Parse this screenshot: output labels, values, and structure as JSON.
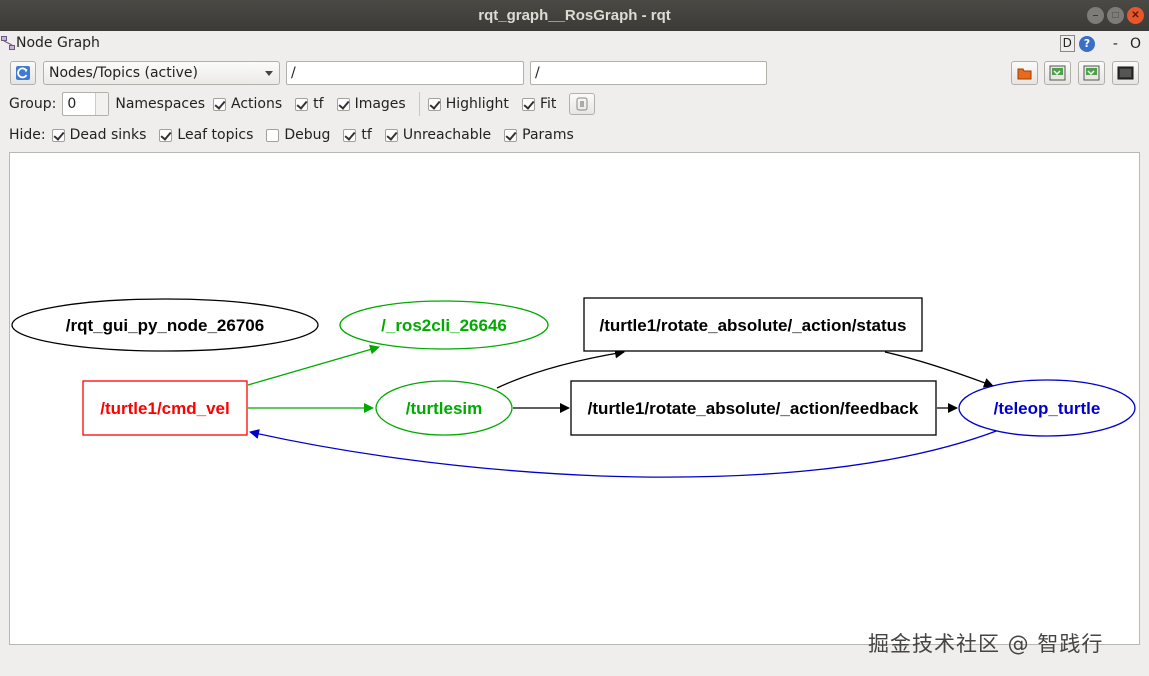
{
  "window": {
    "title": "rqt_graph__RosGraph - rqt",
    "plugin_title": "Node Graph",
    "top_right": {
      "d_label": "D",
      "help": "?",
      "dash": "-",
      "o": "O"
    }
  },
  "toolbar": {
    "refresh_icon": "refresh-icon",
    "mode": "Nodes/Topics (active)",
    "node_filter": "/",
    "topic_filter": "/",
    "buttons": [
      "load-dot-icon",
      "save-dot-icon",
      "save-svg-icon",
      "save-image-icon"
    ]
  },
  "options": {
    "group_label": "Group:",
    "group_value": "0",
    "namespaces": "Namespaces",
    "actions": {
      "label": "Actions",
      "checked": true
    },
    "tf": {
      "label": "tf",
      "checked": true
    },
    "images": {
      "label": "Images",
      "checked": true
    },
    "highlight": {
      "label": "Highlight",
      "checked": true
    },
    "fit": {
      "label": "Fit",
      "checked": true
    }
  },
  "hide": {
    "label": "Hide:",
    "dead_sinks": {
      "label": "Dead sinks",
      "checked": true
    },
    "leaf_topics": {
      "label": "Leaf topics",
      "checked": true
    },
    "debug": {
      "label": "Debug",
      "checked": false
    },
    "tf": {
      "label": "tf",
      "checked": true
    },
    "unreachable": {
      "label": "Unreachable",
      "checked": true
    },
    "params": {
      "label": "Params",
      "checked": true
    }
  },
  "graph": {
    "nodes": {
      "rqt_gui": "/rqt_gui_py_node_26706",
      "ros2cli": "/_ros2cli_26646",
      "cmd_vel": "/turtle1/cmd_vel",
      "turtlesim": "/turtlesim",
      "status": "/turtle1/rotate_absolute/_action/status",
      "feedback": "/turtle1/rotate_absolute/_action/feedback",
      "teleop": "/teleop_turtle"
    },
    "colors": {
      "black": "#000000",
      "green": "#00aa00",
      "red": "#ff0000",
      "blue": "#0000cc"
    }
  },
  "watermark": "掘金技术社区 @ 智践行"
}
